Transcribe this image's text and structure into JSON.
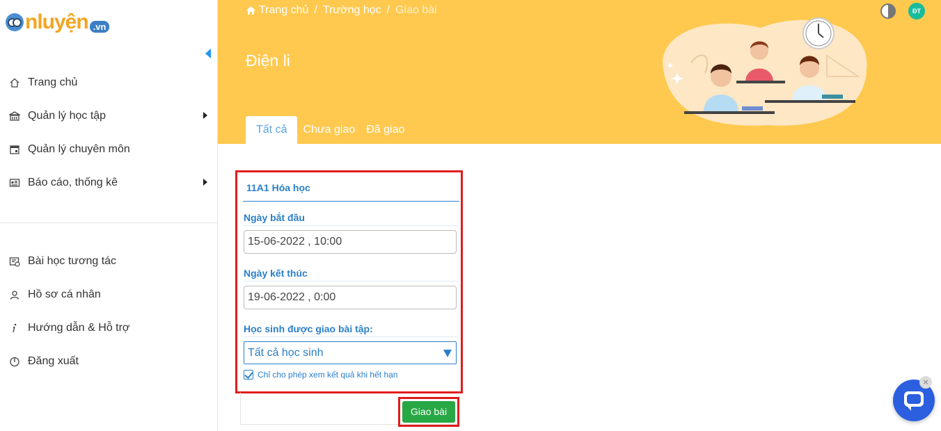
{
  "logo": {
    "wordmark": "nluyện",
    "suffix": ".vn"
  },
  "sidebar": {
    "items": [
      {
        "label": "Trang chủ",
        "icon": "home-icon",
        "has_submenu": false
      },
      {
        "label": "Quản lý học tập",
        "icon": "school-icon",
        "has_submenu": true
      },
      {
        "label": "Quản lý chuyên môn",
        "icon": "calendar-icon",
        "has_submenu": false
      },
      {
        "label": "Báo cáo, thống kê",
        "icon": "report-icon",
        "has_submenu": true
      },
      {
        "label": "Bài học tương tác",
        "icon": "interactive-lesson-icon",
        "has_submenu": false
      },
      {
        "label": "Hồ sơ cá nhân",
        "icon": "user-icon",
        "has_submenu": false
      },
      {
        "label": "Hướng dẫn & Hỗ trợ",
        "icon": "info-icon",
        "has_submenu": false
      },
      {
        "label": "Đăng xuất",
        "icon": "power-icon",
        "has_submenu": false
      }
    ]
  },
  "breadcrumb": {
    "home": "Trang chủ",
    "school": "Trường học",
    "current": "Giao bài"
  },
  "header": {
    "title": "Điện li",
    "avatar_initials": "ĐT"
  },
  "tabs": [
    {
      "label": "Tất cả",
      "active": true
    },
    {
      "label": "Chưa giao",
      "active": false
    },
    {
      "label": "Đã giao",
      "active": false
    }
  ],
  "form": {
    "class_title": "11A1 Hóa học",
    "start_label": "Ngày bắt đầu",
    "start_value": "15-06-2022 , 10:00",
    "end_label": "Ngày kết thúc",
    "end_value": "19-06-2022 , 0:00",
    "students_label": "Học sinh được giao bài tập:",
    "students_value": "Tất cả học sinh",
    "checkbox_label": "Chỉ cho phép xem kết quả khi hết hạn",
    "checkbox_checked": true,
    "submit_label": "Giao bài"
  },
  "colors": {
    "banner": "#ffc94f",
    "accent": "#2b7fc9",
    "submit": "#28a745",
    "highlight": "#e01c1c"
  }
}
